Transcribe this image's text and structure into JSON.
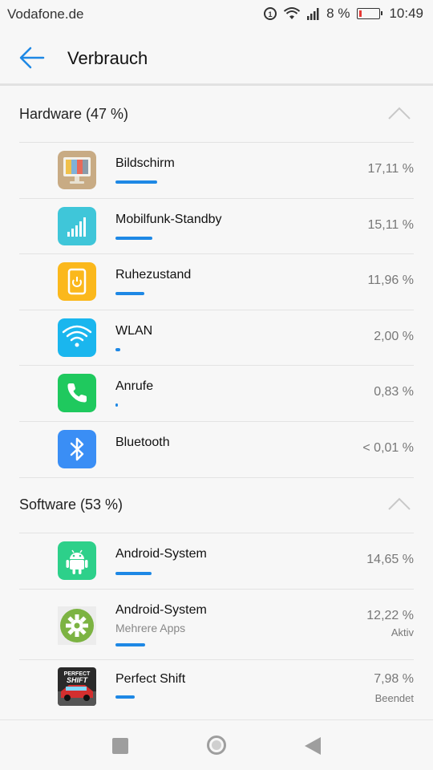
{
  "status_bar": {
    "carrier": "Vodafone.de",
    "battery": "8 %",
    "time": "10:49"
  },
  "header": {
    "title": "Verbrauch"
  },
  "hardware": {
    "title": "Hardware (47 %)",
    "items": [
      {
        "name": "Bildschirm",
        "percent": "17,11 %",
        "usage": 17.11,
        "icon": "screen-icon"
      },
      {
        "name": "Mobilfunk-Standby",
        "percent": "15,11 %",
        "usage": 15.11,
        "icon": "cellular-signal-icon"
      },
      {
        "name": "Ruhezustand",
        "percent": "11,96 %",
        "usage": 11.96,
        "icon": "idle-phone-icon"
      },
      {
        "name": "WLAN",
        "percent": "2,00 %",
        "usage": 2.0,
        "icon": "wifi-icon"
      },
      {
        "name": "Anrufe",
        "percent": "0,83 %",
        "usage": 0.83,
        "icon": "phone-call-icon"
      },
      {
        "name": "Bluetooth",
        "percent": "< 0,01 %",
        "usage": 0.0,
        "icon": "bluetooth-icon"
      }
    ]
  },
  "software": {
    "title": "Software (53 %)",
    "items": [
      {
        "name": "Android-System",
        "subtitle": "",
        "percent": "14,65 %",
        "status": "",
        "usage": 14.65,
        "icon": "android-icon"
      },
      {
        "name": "Android-System",
        "subtitle": "Mehrere Apps",
        "percent": "12,22 %",
        "status": "Aktiv",
        "usage": 12.22,
        "icon": "settings-gear-icon"
      },
      {
        "name": "Perfect Shift",
        "subtitle": "",
        "percent": "7,98 %",
        "status": "Beendet",
        "usage": 7.98,
        "icon": "perfect-shift-app-icon"
      }
    ]
  },
  "colors": {
    "accent": "#1e88e5"
  }
}
